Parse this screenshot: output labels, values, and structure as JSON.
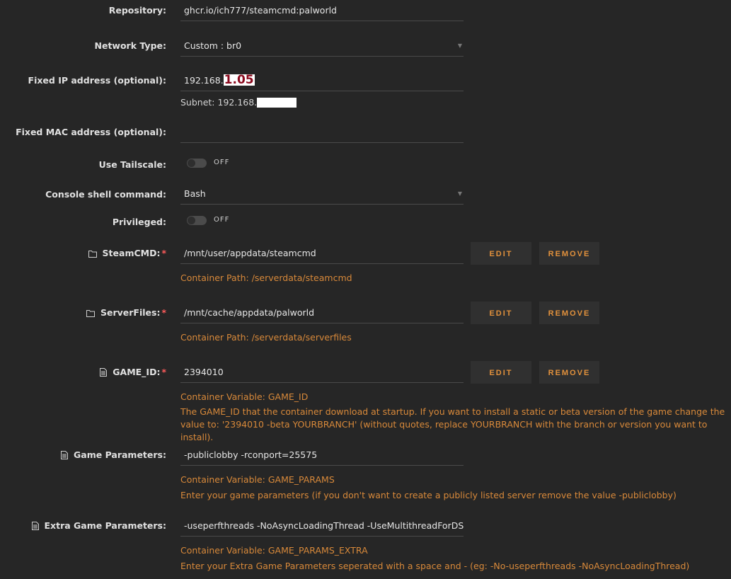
{
  "repository": {
    "label": "Repository:",
    "value": "ghcr.io/ich777/steamcmd:palworld"
  },
  "network_type": {
    "label": "Network Type:",
    "value": "Custom : br0"
  },
  "fixed_ip": {
    "label": "Fixed IP address (optional):",
    "value_prefix": "192.168.",
    "value_highlight": "1.05"
  },
  "subnet": {
    "text": "Subnet: 192.168."
  },
  "fixed_mac": {
    "label": "Fixed MAC address (optional):",
    "value": ""
  },
  "tailscale": {
    "label": "Use Tailscale:",
    "state": "OFF"
  },
  "console_shell": {
    "label": "Console shell command:",
    "value": "Bash"
  },
  "privileged": {
    "label": "Privileged:",
    "state": "OFF"
  },
  "buttons": {
    "edit": "EDIT",
    "remove": "REMOVE"
  },
  "steamcmd": {
    "label": "SteamCMD:",
    "required": "*",
    "value": "/mnt/user/appdata/steamcmd",
    "hint": "Container Path: /serverdata/steamcmd"
  },
  "serverfiles": {
    "label": "ServerFiles:",
    "required": "*",
    "value": "/mnt/cache/appdata/palworld",
    "hint": "Container Path: /serverdata/serverfiles"
  },
  "game_id": {
    "label": "GAME_ID:",
    "required": "*",
    "value": "2394010",
    "hint": "Container Variable: GAME_ID",
    "description": "The GAME_ID that the container download at startup. If you want to install a static or beta version of the game change the value to: '2394010 -beta YOURBRANCH' (without quotes, replace YOURBRANCH with the branch or version you want to install)."
  },
  "game_params": {
    "label": "Game Parameters:",
    "value": "-publiclobby -rconport=25575",
    "hint": "Container Variable: GAME_PARAMS",
    "description": "Enter your game parameters (if you don't want to create a publicly listed server remove the value -publiclobby)"
  },
  "extra_params": {
    "label": "Extra Game Parameters:",
    "value": "-useperfthreads -NoAsyncLoadingThread -UseMultithreadForDS",
    "hint": "Container Variable: GAME_PARAMS_EXTRA",
    "description": "Enter your Extra Game Parameters seperated with a space and - (eg: -No-useperfthreads -NoAsyncLoadingThread)"
  }
}
